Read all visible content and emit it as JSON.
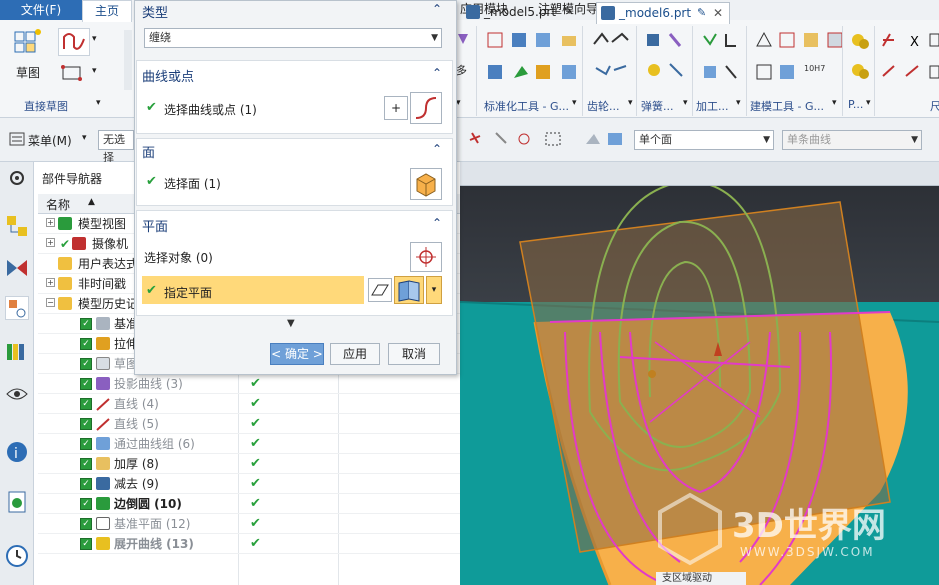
{
  "ribbon": {
    "file_tab": "文件(F)",
    "home_tab": "主页",
    "tabs": [
      "应用模块",
      "注塑模向导"
    ],
    "sketch_label": "草图",
    "direct_sketch_group": "直接草图",
    "more_label": "多",
    "groups": [
      "标准化工具 - G...",
      "齿轮...",
      "弹簧...",
      "加工...",
      "建模工具 - G...",
      "P...",
      "尺"
    ],
    "icon_10h7": "10H7"
  },
  "toolbar2": {
    "menu_label": "菜单(M)",
    "filter_partial": "无选择",
    "face_filter": "单个面",
    "curve_filter": "单条曲线"
  },
  "navigator": {
    "title": "部件导航器",
    "col_name": "名称",
    "rows": [
      {
        "label": "模型视图",
        "style": "normal"
      },
      {
        "label": "摄像机",
        "style": "normal"
      },
      {
        "label": "用户表达式",
        "style": "normal"
      },
      {
        "label": "非时间戳",
        "style": "normal"
      },
      {
        "label": "模型历史记录",
        "style": "normal"
      },
      {
        "label": "基准",
        "style": "normal"
      },
      {
        "label": "拉伸",
        "style": "normal"
      },
      {
        "label": "草图",
        "style": "gray"
      },
      {
        "label": "投影曲线 (3)",
        "style": "gray"
      },
      {
        "label": "直线 (4)",
        "style": "gray"
      },
      {
        "label": "直线 (5)",
        "style": "gray"
      },
      {
        "label": "通过曲线组 (6)",
        "style": "gray"
      },
      {
        "label": "加厚 (8)",
        "style": "normal"
      },
      {
        "label": "减去 (9)",
        "style": "normal"
      },
      {
        "label": "边倒圆 (10)",
        "style": "bold"
      },
      {
        "label": "基准平面 (12)",
        "style": "gray"
      },
      {
        "label": "展开曲线 (13)",
        "style": "graybold"
      }
    ]
  },
  "dialog": {
    "type_title": "类型",
    "type_value": "缠绕",
    "curve_title": "曲线或点",
    "curve_select": "选择曲线或点 (1)",
    "face_title": "面",
    "face_select": "选择面 (1)",
    "plane_title": "平面",
    "plane_select_object": "选择对象 (0)",
    "plane_specify": "指定平面",
    "ok": "< 确定 >",
    "apply": "应用",
    "cancel": "取消"
  },
  "graphics": {
    "tab1": "_model5.prt",
    "tab2": "_model6.prt",
    "watermark_title": "3D世界网",
    "watermark_url": "WWW.3DSJW.COM",
    "bottom_label": "支区域驱动"
  },
  "colors": {
    "accent": "#2d6db5",
    "highlight": "#ffd97a",
    "check": "#28a03c",
    "part_orange": "#f7b04a",
    "cylinder_teal": "#0f9b99",
    "plane_brown": "#8a6a44",
    "curve_magenta": "#e23ac8",
    "curve_green": "#7fae4a"
  }
}
